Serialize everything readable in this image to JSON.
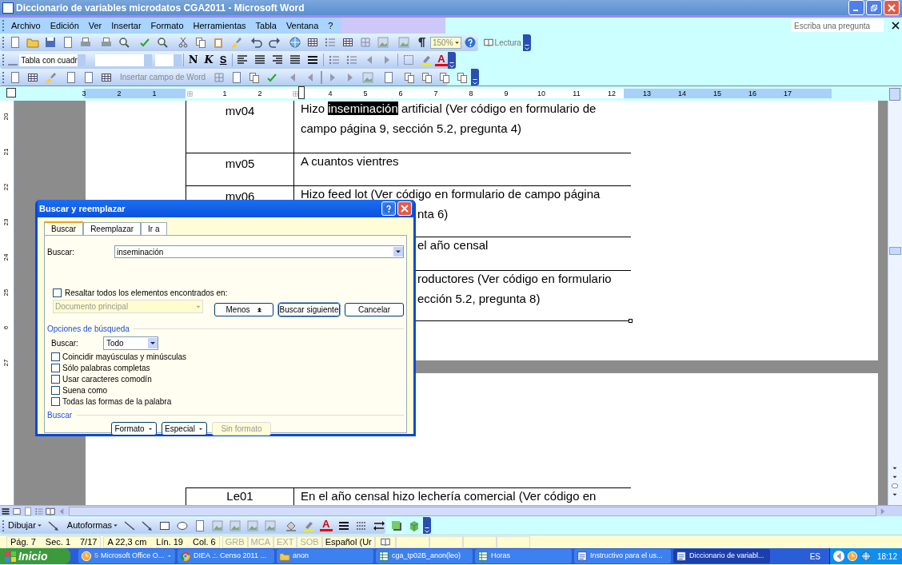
{
  "window": {
    "title": "Diccionario de variables microdatos CGA2011 - Microsoft Word"
  },
  "menu": [
    "Archivo",
    "Edición",
    "Ver",
    "Insertar",
    "Formato",
    "Herramientas",
    "Tabla",
    "Ventana",
    "?"
  ],
  "help_box": {
    "placeholder": "Escriba una pregunta"
  },
  "standard_toolbar": {
    "zoom": "150%",
    "reading_button": "Lectura"
  },
  "format_toolbar": {
    "style": "Tabla con cuadr",
    "bold": "N",
    "italic": "K",
    "underline": "S",
    "font_color": "A"
  },
  "mail_toolbar": {
    "insert_field": "Insertar campo de Word",
    "insert_field_disabled": true
  },
  "ruler": [
    {
      "kind": "num",
      "text": "3"
    },
    {
      "kind": "num",
      "text": "2"
    },
    {
      "kind": "num",
      "text": "1"
    },
    {
      "kind": "grid"
    },
    {
      "kind": "num",
      "text": "1"
    },
    {
      "kind": "num",
      "text": "2"
    },
    {
      "kind": "grid"
    },
    {
      "kind": "num",
      "text": "4"
    },
    {
      "kind": "num",
      "text": "5"
    },
    {
      "kind": "num",
      "text": "6"
    },
    {
      "kind": "num",
      "text": "7"
    },
    {
      "kind": "num",
      "text": "8"
    },
    {
      "kind": "num",
      "text": "9"
    },
    {
      "kind": "num",
      "text": "10"
    },
    {
      "kind": "num",
      "text": "11"
    },
    {
      "kind": "num",
      "text": "12"
    },
    {
      "kind": "num",
      "text": "13"
    },
    {
      "kind": "num",
      "text": "14"
    },
    {
      "kind": "num",
      "text": "15"
    },
    {
      "kind": "num",
      "text": "16"
    },
    {
      "kind": "num",
      "text": "17"
    }
  ],
  "vertical_ruler": [
    "20",
    "21",
    "22",
    "23",
    "24",
    "25",
    "6",
    "27"
  ],
  "table_rows": [
    {
      "code": "mv04",
      "lines": [
        {
          "partial": false,
          "segments": [
            {
              "text": "Hizo ",
              "selected": false
            },
            {
              "text": "inseminación",
              "selected": true
            },
            {
              "text": " artificial (Ver código en formulario de",
              "selected": false
            }
          ]
        },
        {
          "partial": false,
          "segments": [
            {
              "text": "campo página 9, sección 5.2, pregunta 4)",
              "selected": false
            }
          ]
        }
      ]
    },
    {
      "code": "mv05",
      "lines": [
        {
          "partial": false,
          "segments": [
            {
              "text": "A cuantos vientres",
              "selected": false
            }
          ]
        }
      ]
    },
    {
      "code": "mv06",
      "lines": [
        {
          "partial": false,
          "segments": [
            {
              "text": "Hizo feed lot (Ver código en formulario de campo página",
              "selected": false
            }
          ]
        },
        {
          "partial": true,
          "segments": [
            {
              "text": "nta 6)",
              "selected": false
            }
          ]
        }
      ]
    },
    {
      "lines": [
        {
          "partial": true,
          "segments": [
            {
              "text": "el año censal",
              "selected": false
            }
          ]
        }
      ]
    },
    {
      "lines": [
        {
          "partial": true,
          "segments": [
            {
              "text": "roductores (Ver código en formulario",
              "selected": false
            }
          ]
        },
        {
          "partial": true,
          "segments": [
            {
              "text": "ección 5.2, pregunta 8)",
              "selected": false
            }
          ]
        }
      ]
    }
  ],
  "page2_rows": [
    {
      "code": "Le01",
      "lines": [
        {
          "partial": false,
          "segments": [
            {
              "text": "En el año censal hizo lechería comercial (Ver código en",
              "selected": false
            }
          ]
        }
      ]
    }
  ],
  "dialog": {
    "title": "Buscar y reemplazar",
    "tabs": [
      {
        "label": "Buscar",
        "selected": true
      },
      {
        "label": "Reemplazar",
        "selected": false
      },
      {
        "label": "Ir a",
        "selected": false
      }
    ],
    "find_label": "Buscar:",
    "find_value": "inseminación",
    "highlight_all": {
      "label": "Resaltar todos los elementos encontrados en:",
      "checked": false
    },
    "highlight_scope": {
      "value": "Documento principal",
      "disabled": true
    },
    "buttons": [
      {
        "label": "Menos",
        "kind": "less"
      },
      {
        "label": "Buscar siguiente",
        "kind": "default"
      },
      {
        "label": "Cancelar",
        "kind": "normal"
      }
    ],
    "options_title": "Opciones de búsqueda",
    "search_label": "Buscar:",
    "search_value": "Todo",
    "options": [
      {
        "label": "Coincidir mayúsculas y minúsculas",
        "checked": false
      },
      {
        "label": "Sólo palabras completas",
        "checked": false
      },
      {
        "label": "Usar caracteres comodín",
        "checked": false
      },
      {
        "label": "Suena como",
        "checked": false
      },
      {
        "label": "Todas las formas de la palabra",
        "checked": false
      }
    ],
    "format_title": "Buscar",
    "format_buttons": [
      {
        "label": "Formato",
        "kind": "menu",
        "disabled": false
      },
      {
        "label": "Especial",
        "kind": "menu",
        "disabled": false
      },
      {
        "label": "Sin formato",
        "kind": "plain",
        "disabled": true
      }
    ]
  },
  "draw_toolbar": {
    "draw_menu": "Dibujar",
    "autoshapes_menu": "Autoformas",
    "font_color": "A"
  },
  "status_bar": {
    "groups": [
      [
        "Pág. 7",
        "Sec. 1",
        "7/17"
      ],
      [
        "A 22,3 cm",
        "Lín. 19",
        "Col. 6"
      ]
    ],
    "modes": [
      {
        "label": "GRB",
        "on": false
      },
      {
        "label": "MCA",
        "on": false
      },
      {
        "label": "EXT",
        "on": false
      },
      {
        "label": "SOB",
        "on": false
      }
    ],
    "language": "Español (Ur"
  },
  "taskbar": {
    "start": "Inicio",
    "tasks": [
      {
        "count": "5",
        "label": "Microsoft Office O...",
        "kind": "clock",
        "has_menu": true,
        "selected": false
      },
      {
        "label": "DIEA .:. Censo 2011 ...",
        "kind": "browser",
        "has_menu": false,
        "selected": false
      },
      {
        "label": "anon",
        "kind": "folder",
        "has_menu": false,
        "selected": false
      },
      {
        "label": "cga_tp02B_anon(leo)",
        "kind": "sheet",
        "has_menu": false,
        "selected": false
      },
      {
        "label": "Horas",
        "kind": "sheet",
        "has_menu": false,
        "selected": false
      },
      {
        "label": "Instructivo para el us...",
        "kind": "doc",
        "has_menu": false,
        "selected": false
      },
      {
        "label": "Diccionario de variabl...",
        "kind": "doc",
        "has_menu": false,
        "selected": true
      }
    ],
    "language": "ES",
    "clock": "18:12"
  }
}
